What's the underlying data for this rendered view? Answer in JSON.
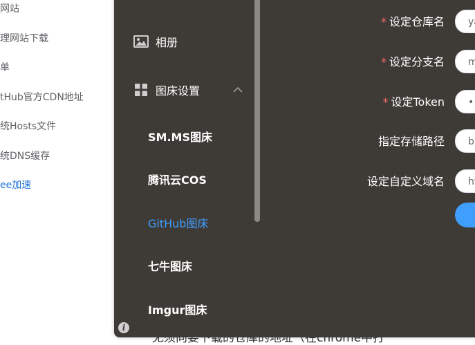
{
  "background_page": {
    "items": [
      {
        "label": "网站",
        "link": false
      },
      {
        "label": "理网站下载",
        "link": false
      },
      {
        "label": "单",
        "link": false
      },
      {
        "label": "tHub官方CDN地址",
        "link": false
      },
      {
        "label": "统Hosts文件",
        "link": false
      },
      {
        "label": "统DNS缓存",
        "link": false
      },
      {
        "label": "ee加速",
        "link": true
      }
    ],
    "footer_text": "无须向要下载的仓库的地址（在chrome中打"
  },
  "sidebar": {
    "album_label": "相册",
    "settings_label": "图床设置",
    "sub_items": [
      {
        "label": "SM.MS图床",
        "active": false
      },
      {
        "label": "腾讯云COS",
        "active": false
      },
      {
        "label": "GitHub图床",
        "active": true
      },
      {
        "label": "七牛图床",
        "active": false
      },
      {
        "label": "Imgur图床",
        "active": false
      }
    ]
  },
  "form": {
    "fields": [
      {
        "label": "设定仓库名",
        "required": true,
        "value": "ya"
      },
      {
        "label": "设定分支名",
        "required": true,
        "value": "m"
      },
      {
        "label": "设定Token",
        "required": true,
        "value": "••"
      },
      {
        "label": "指定存储路径",
        "required": false,
        "value": "b"
      },
      {
        "label": "设定自定义域名",
        "required": false,
        "value": "ht"
      }
    ]
  },
  "colors": {
    "window_bg": "#3e3a36",
    "accent": "#409eff",
    "required": "#f56c6c",
    "link": "#1e6fd9"
  }
}
